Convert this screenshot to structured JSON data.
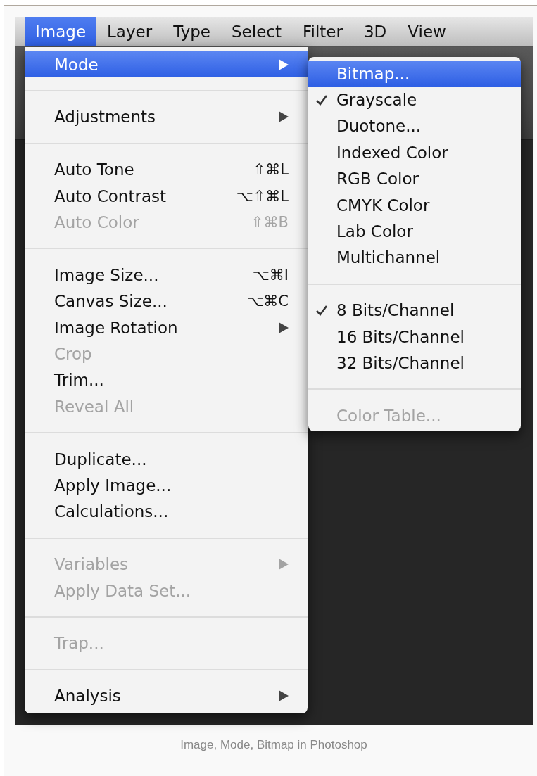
{
  "menubar": [
    {
      "label": "Image",
      "selected": true
    },
    {
      "label": "Layer",
      "selected": false
    },
    {
      "label": "Type",
      "selected": false
    },
    {
      "label": "Select",
      "selected": false
    },
    {
      "label": "Filter",
      "selected": false
    },
    {
      "label": "3D",
      "selected": false
    },
    {
      "label": "View",
      "selected": false
    }
  ],
  "menu": [
    {
      "kind": "item",
      "label": "Mode",
      "submenu": true,
      "disabled": false,
      "selected": true
    },
    {
      "kind": "separator"
    },
    {
      "kind": "item",
      "label": "Adjustments",
      "submenu": true,
      "disabled": false,
      "selected": false
    },
    {
      "kind": "separator"
    },
    {
      "kind": "item",
      "label": "Auto Tone",
      "shortcut": "⇧⌘L",
      "disabled": false,
      "selected": false
    },
    {
      "kind": "item",
      "label": "Auto Contrast",
      "shortcut": "⌥⇧⌘L",
      "disabled": false,
      "selected": false
    },
    {
      "kind": "item",
      "label": "Auto Color",
      "shortcut": "⇧⌘B",
      "disabled": true,
      "selected": false
    },
    {
      "kind": "separator"
    },
    {
      "kind": "item",
      "label": "Image Size...",
      "shortcut": "⌥⌘I",
      "disabled": false,
      "selected": false
    },
    {
      "kind": "item",
      "label": "Canvas Size...",
      "shortcut": "⌥⌘C",
      "disabled": false,
      "selected": false
    },
    {
      "kind": "item",
      "label": "Image Rotation",
      "submenu": true,
      "disabled": false,
      "selected": false
    },
    {
      "kind": "item",
      "label": "Crop",
      "disabled": true,
      "selected": false
    },
    {
      "kind": "item",
      "label": "Trim...",
      "disabled": false,
      "selected": false
    },
    {
      "kind": "item",
      "label": "Reveal All",
      "disabled": true,
      "selected": false
    },
    {
      "kind": "separator"
    },
    {
      "kind": "item",
      "label": "Duplicate...",
      "disabled": false,
      "selected": false
    },
    {
      "kind": "item",
      "label": "Apply Image...",
      "disabled": false,
      "selected": false
    },
    {
      "kind": "item",
      "label": "Calculations...",
      "disabled": false,
      "selected": false
    },
    {
      "kind": "separator"
    },
    {
      "kind": "item",
      "label": "Variables",
      "submenu": true,
      "disabled": true,
      "selected": false
    },
    {
      "kind": "item",
      "label": "Apply Data Set...",
      "disabled": true,
      "selected": false
    },
    {
      "kind": "separator"
    },
    {
      "kind": "item",
      "label": "Trap...",
      "disabled": true,
      "selected": false
    },
    {
      "kind": "separator"
    },
    {
      "kind": "item",
      "label": "Analysis",
      "submenu": true,
      "disabled": false,
      "selected": false
    }
  ],
  "submenu": [
    {
      "kind": "item",
      "label": "Bitmap...",
      "checked": false,
      "disabled": false,
      "selected": true
    },
    {
      "kind": "item",
      "label": "Grayscale",
      "checked": true,
      "disabled": false,
      "selected": false
    },
    {
      "kind": "item",
      "label": "Duotone...",
      "checked": false,
      "disabled": false,
      "selected": false
    },
    {
      "kind": "item",
      "label": "Indexed Color",
      "checked": false,
      "disabled": false,
      "selected": false
    },
    {
      "kind": "item",
      "label": "RGB Color",
      "checked": false,
      "disabled": false,
      "selected": false
    },
    {
      "kind": "item",
      "label": "CMYK Color",
      "checked": false,
      "disabled": false,
      "selected": false
    },
    {
      "kind": "item",
      "label": "Lab Color",
      "checked": false,
      "disabled": false,
      "selected": false
    },
    {
      "kind": "item",
      "label": "Multichannel",
      "checked": false,
      "disabled": false,
      "selected": false
    },
    {
      "kind": "separator"
    },
    {
      "kind": "item",
      "label": "8 Bits/Channel",
      "checked": true,
      "disabled": false,
      "selected": false
    },
    {
      "kind": "item",
      "label": "16 Bits/Channel",
      "checked": false,
      "disabled": false,
      "selected": false
    },
    {
      "kind": "item",
      "label": "32 Bits/Channel",
      "checked": false,
      "disabled": false,
      "selected": false
    },
    {
      "kind": "separator"
    },
    {
      "kind": "item",
      "label": "Color Table...",
      "checked": false,
      "disabled": true,
      "selected": false
    }
  ],
  "caption": "Image, Mode, Bitmap in Photoshop"
}
